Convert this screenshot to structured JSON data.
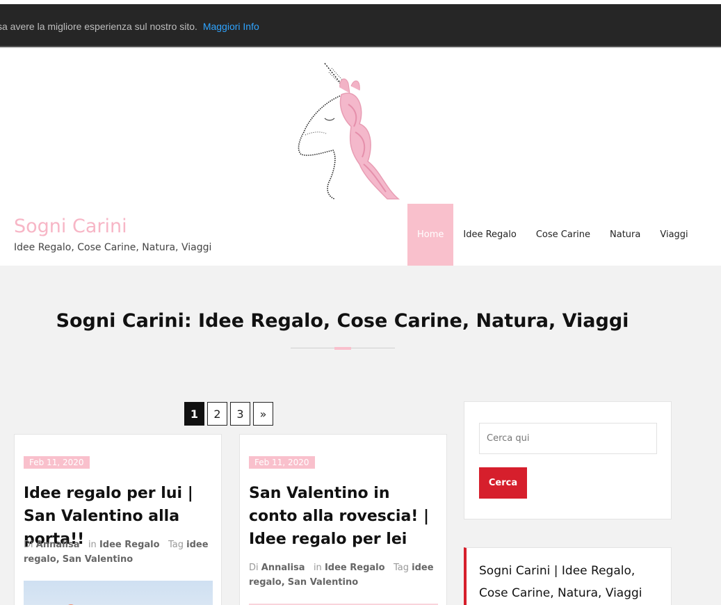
{
  "cookie": {
    "text": "sa avere la migliore esperienza sul nostro sito.",
    "link": "Maggiori Info"
  },
  "site": {
    "title": "Sogni Carini",
    "tagline": "Idee Regalo, Cose Carine, Natura, Viaggi"
  },
  "nav": {
    "items": [
      "Home",
      "Idee Regalo",
      "Cose Carine",
      "Natura",
      "Viaggi"
    ],
    "active": "Home"
  },
  "hero": {
    "title": "Sogni Carini: Idee Regalo, Cose Carine, Natura, Viaggi"
  },
  "pagination": {
    "pages": [
      "1",
      "2",
      "3",
      "»"
    ],
    "current": "1"
  },
  "posts": [
    {
      "date": "Feb 11, 2020",
      "title": "Idee regalo per lui | San Valentino alla porta!!",
      "by_label": "Di",
      "author": "Annalisa",
      "in_label": "in",
      "category": "Idee Regalo",
      "tag_label": "Tag",
      "tags": [
        "idee regalo,",
        "San Valentino"
      ]
    },
    {
      "date": "Feb 11, 2020",
      "title": "San Valentino in conto alla rovescia! | Idee regalo per lei",
      "by_label": "Di",
      "author": "Annalisa",
      "in_label": "in",
      "category": "Idee Regalo",
      "tag_label": "Tag",
      "tags": [
        "idee regalo,",
        "San Valentino"
      ]
    }
  ],
  "search": {
    "placeholder": "Cerca qui",
    "button": "Cerca"
  },
  "widget": {
    "title": "Sogni Carini | Idee Regalo, Cose Carine, Natura, Viaggi"
  },
  "colors": {
    "accent_pink": "#f9c0cc",
    "accent_red": "#d61f2c",
    "cookie_bg": "#262626",
    "link_blue": "#2fa4ff"
  },
  "icons": {
    "logo": "unicorn-logo"
  }
}
